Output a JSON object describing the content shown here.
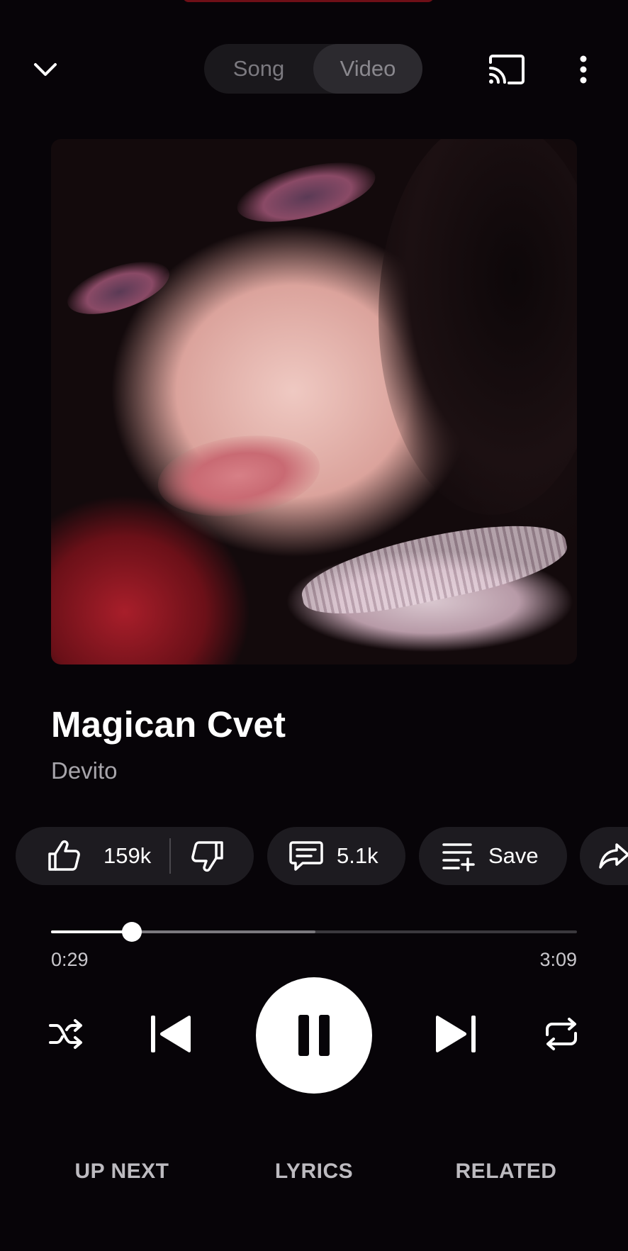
{
  "header": {
    "segments": [
      {
        "label": "Song",
        "active": false
      },
      {
        "label": "Video",
        "active": true
      }
    ],
    "icons": {
      "collapse": "chevron-down-icon",
      "cast": "cast-icon",
      "more": "more-vert-icon"
    }
  },
  "track": {
    "title": "Magican Cvet",
    "artist": "Devito"
  },
  "actions": {
    "likes": "159k",
    "comments": "5.1k",
    "save_label": "Save"
  },
  "playback": {
    "current_time": "0:29",
    "total_time": "3:09",
    "played_fraction": 0.153,
    "buffered_fraction": 0.503,
    "state": "playing"
  },
  "tabs": [
    {
      "label": "UP NEXT"
    },
    {
      "label": "LYRICS"
    },
    {
      "label": "RELATED"
    }
  ],
  "colors": {
    "background": "#070408",
    "chip": "#1d1b20",
    "accent": "#6e0f17"
  }
}
